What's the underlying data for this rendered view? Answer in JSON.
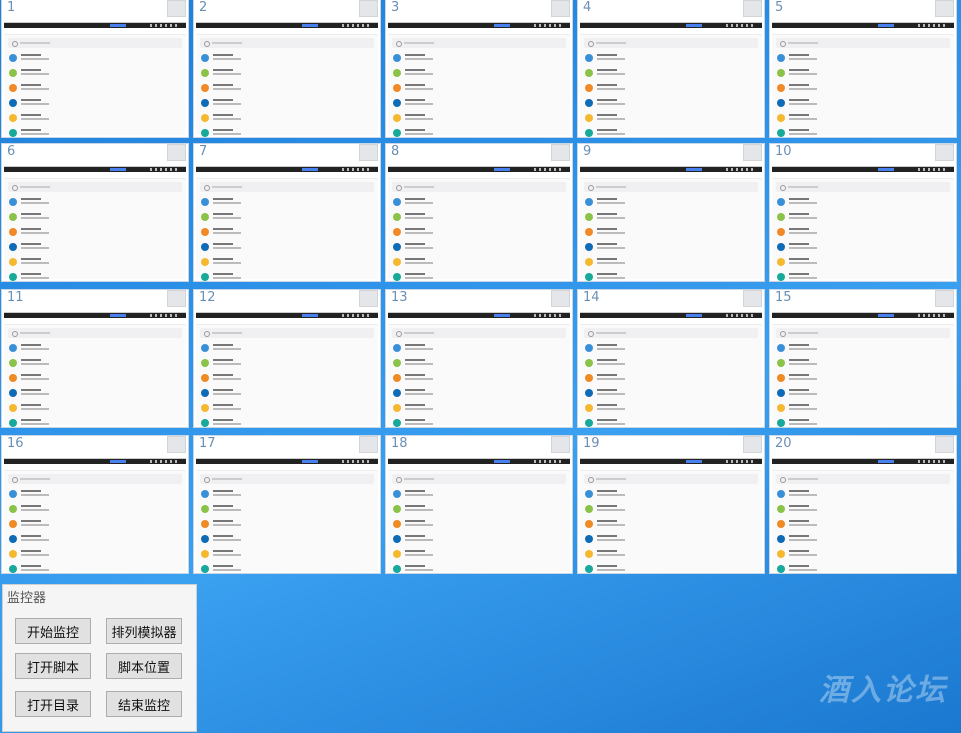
{
  "tiles": [
    "1",
    "2",
    "3",
    "4",
    "5",
    "6",
    "7",
    "8",
    "9",
    "10",
    "11",
    "12",
    "13",
    "14",
    "15",
    "16",
    "17",
    "18",
    "19",
    "20"
  ],
  "panel": {
    "title": "监控器",
    "buttons": {
      "start_monitor": "开始监控",
      "arrange_emulators": "排列模拟器",
      "open_script": "打开脚本",
      "script_location": "脚本位置",
      "open_directory": "打开目录",
      "end_monitor": "结束监控"
    }
  },
  "watermark": "酒入论坛",
  "colors": {
    "desktop": "#2a8ee6",
    "tile_number": "#6a8fb5",
    "button_face": "#e1e1e1"
  }
}
